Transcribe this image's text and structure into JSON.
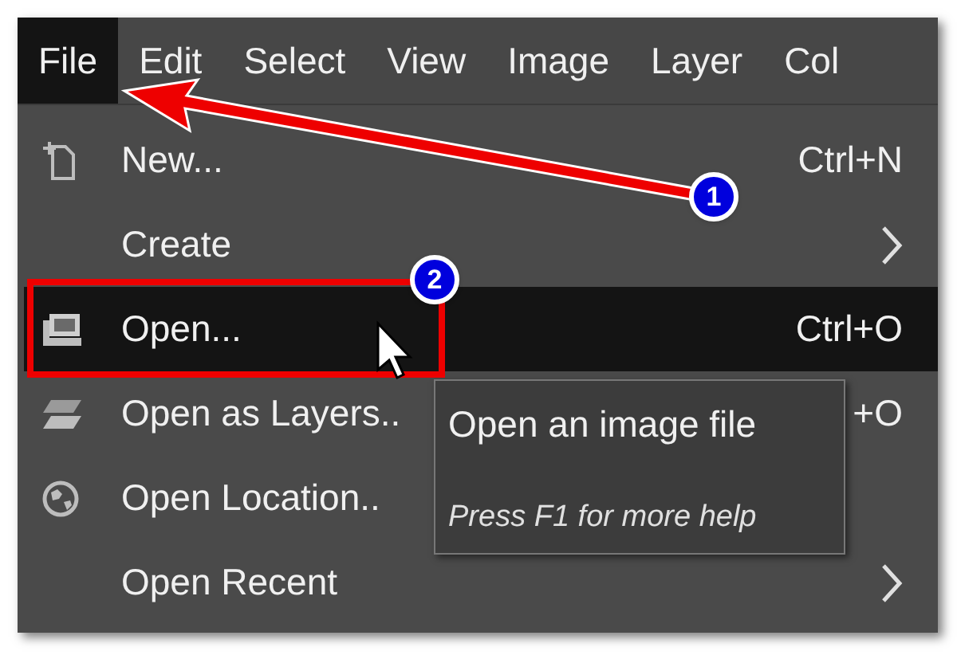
{
  "menubar": [
    {
      "label": "File",
      "selected": true
    },
    {
      "label": "Edit",
      "selected": false
    },
    {
      "label": "Select",
      "selected": false
    },
    {
      "label": "View",
      "selected": false
    },
    {
      "label": "Image",
      "selected": false
    },
    {
      "label": "Layer",
      "selected": false
    },
    {
      "label": "Col",
      "selected": false
    }
  ],
  "menu": [
    {
      "label": "New...",
      "shortcut": "Ctrl+N",
      "kind": "new",
      "submenu": false,
      "selected": false
    },
    {
      "label": "Create",
      "kind": "plain",
      "submenu": true,
      "selected": false
    },
    {
      "label": "Open...",
      "shortcut": "Ctrl+O",
      "kind": "open",
      "submenu": false,
      "selected": true
    },
    {
      "label": "Open as Layers..",
      "shortcut": "+O",
      "kind": "layers",
      "submenu": false,
      "selected": false
    },
    {
      "label": "Open Location..",
      "kind": "globe",
      "submenu": false,
      "selected": false
    },
    {
      "label": "Open Recent",
      "kind": "plain",
      "submenu": true,
      "selected": false
    }
  ],
  "tooltip": {
    "title": "Open an image file",
    "hint": "Press F1 for more help"
  },
  "annotations": [
    {
      "number": "1"
    },
    {
      "number": "2"
    }
  ]
}
